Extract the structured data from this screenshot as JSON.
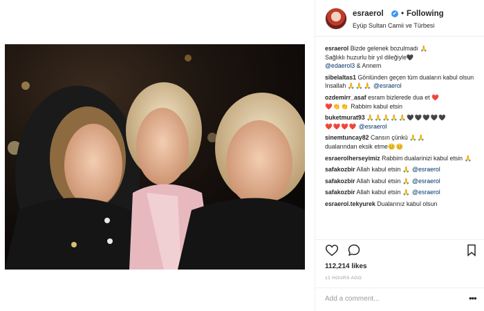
{
  "post": {
    "username": "esraerol",
    "verified_glyph": "✔",
    "separator": "•",
    "follow_state": "Following",
    "location": "Eyüp Sultan Camii ve Türbesi"
  },
  "comments": [
    {
      "user": "esraerol",
      "text": "Bizde gelenek bozulmadı",
      "emoji": "🙏",
      "text2": "Sağlıklı huzurlu bir yıl dileğiyle",
      "emoji2": "🖤",
      "mention": "@edaerol3",
      "text3": "& Annem"
    },
    {
      "user": "sibelaltas1",
      "text": "Gönlünden geçen tüm duaların kabul olsun Insallah",
      "emoji": "🙏🙏🙏",
      "mention": "@esraerol"
    },
    {
      "user": "ozdemirr_asaf",
      "text": "esram bizlerede dua et",
      "emoji": "❤️",
      "emoji2": "❤️👏👏",
      "text2": "Rabbim kabul etsin"
    },
    {
      "user": "buketmurat93",
      "emoji": "🙏🙏🙏🙏🙏",
      "emoji2": "🖤🖤🖤🖤🖤",
      "emoji3": "❤️❤️❤️❤️",
      "mention": "@esraerol"
    },
    {
      "user": "sinemtuncay82",
      "text": "Cansın çünkü",
      "emoji": "🙏🙏",
      "text2": "dualarından eksik etme",
      "emoji2": "😊😊"
    },
    {
      "user": "esraerolherseyimiz",
      "text": "Rabbim dualarinizi kabul etsin",
      "emoji": "🙏"
    },
    {
      "user": "safakozbir",
      "text": "Allah kabul etsin",
      "emoji": "🙏",
      "mention": "@esraerol"
    },
    {
      "user": "safakozbir",
      "text": "Allah kabul etsin",
      "emoji": "🙏",
      "mention": "@esraerol"
    },
    {
      "user": "safakozbir",
      "text": "Allah kabul etsin",
      "emoji": "🙏",
      "mention": "@esraerol"
    },
    {
      "user": "esraerol.tekyurek",
      "text": "Dualarınız kabul olsun"
    }
  ],
  "stats": {
    "likes": "112,214 likes",
    "time": "12 HOURS AGO"
  },
  "composer": {
    "placeholder": "Add a comment...",
    "more_label": "•••"
  },
  "icons": {
    "like": "heart-icon",
    "comment": "speech-bubble-icon",
    "save": "bookmark-icon"
  },
  "colors": {
    "mention": "#003569",
    "verified": "#3897f0",
    "muted": "#999999"
  }
}
